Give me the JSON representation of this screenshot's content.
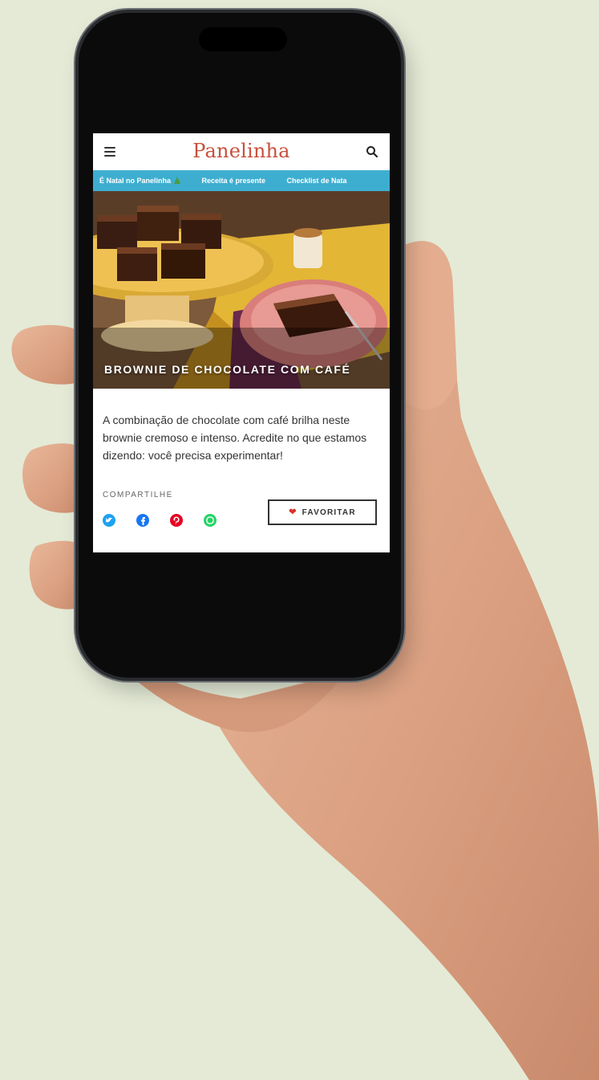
{
  "header": {
    "brand": "Panelinha"
  },
  "nav": {
    "items": [
      "É Natal no Panelinha",
      "Receita é presente",
      "Checklist de Nata"
    ]
  },
  "hero": {
    "title": "BROWNIE DE CHOCOLATE COM CAFÉ"
  },
  "article": {
    "description": "A combinação de chocolate com café brilha neste brownie cremoso e intenso. Acredite no que estamos dizendo: você precisa experimentar!"
  },
  "share": {
    "label": "COMPARTILHE",
    "networks": [
      {
        "name": "twitter",
        "icon": "twitter-icon",
        "color": "#1da1f2"
      },
      {
        "name": "facebook",
        "icon": "facebook-icon",
        "color": "#1877f2"
      },
      {
        "name": "pinterest",
        "icon": "pinterest-icon",
        "color": "#e60023"
      },
      {
        "name": "whatsapp",
        "icon": "whatsapp-icon",
        "color": "#25d366"
      }
    ]
  },
  "favorite": {
    "label": "FAVORITAR",
    "icon": "heart-icon"
  },
  "colors": {
    "brand": "#c8503c",
    "nav": "#3eaed0",
    "background": "#e4ead6"
  }
}
